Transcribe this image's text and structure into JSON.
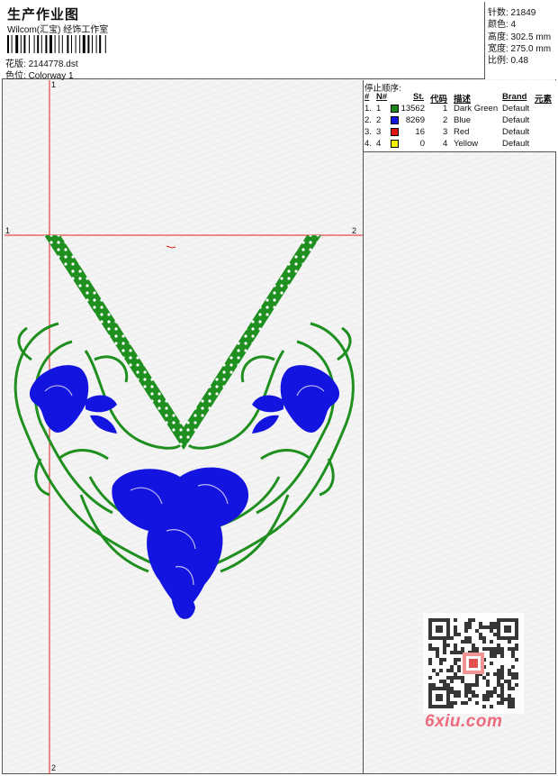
{
  "header": {
    "title": "生产作业图",
    "subtitle": "Wilcom(汇宝) 经饰工作室",
    "pattern_label": "花版:",
    "pattern_value": "2144778.dst",
    "colorway_label": "色位:",
    "colorway_value": "Colorway 1"
  },
  "stats": {
    "stitches": "针数: 21849",
    "colors": "颜色: 4",
    "height": "高度: 302.5 mm",
    "width": "宽度: 275.0 mm",
    "scale": "比例: 0.48"
  },
  "stop_sequence": {
    "caption": "停止顺序:",
    "headers": [
      "#",
      "N#",
      "St.",
      "代码",
      "描述",
      "Brand",
      "元素"
    ],
    "rows": [
      {
        "num": "1.",
        "n": "1",
        "color": "#1a8a1a",
        "st": "13562",
        "code": "1",
        "desc": "Dark Green",
        "brand": "Default"
      },
      {
        "num": "2.",
        "n": "2",
        "color": "#1414e6",
        "st": "8269",
        "code": "2",
        "desc": "Blue",
        "brand": "Default"
      },
      {
        "num": "3.",
        "n": "3",
        "color": "#e61414",
        "st": "16",
        "code": "3",
        "desc": "Red",
        "brand": "Default"
      },
      {
        "num": "4.",
        "n": "4",
        "color": "#f0f000",
        "st": "0",
        "code": "4",
        "desc": "Yellow",
        "brand": "Default"
      }
    ]
  },
  "axes": {
    "v_top": "1",
    "v_bottom": "2",
    "h_left": "1",
    "h_right": "2"
  },
  "watermark": "6xiu.com",
  "colors": {
    "green": "#1f8f1f",
    "blue": "#1414e0",
    "guide_red": "#e02020"
  }
}
